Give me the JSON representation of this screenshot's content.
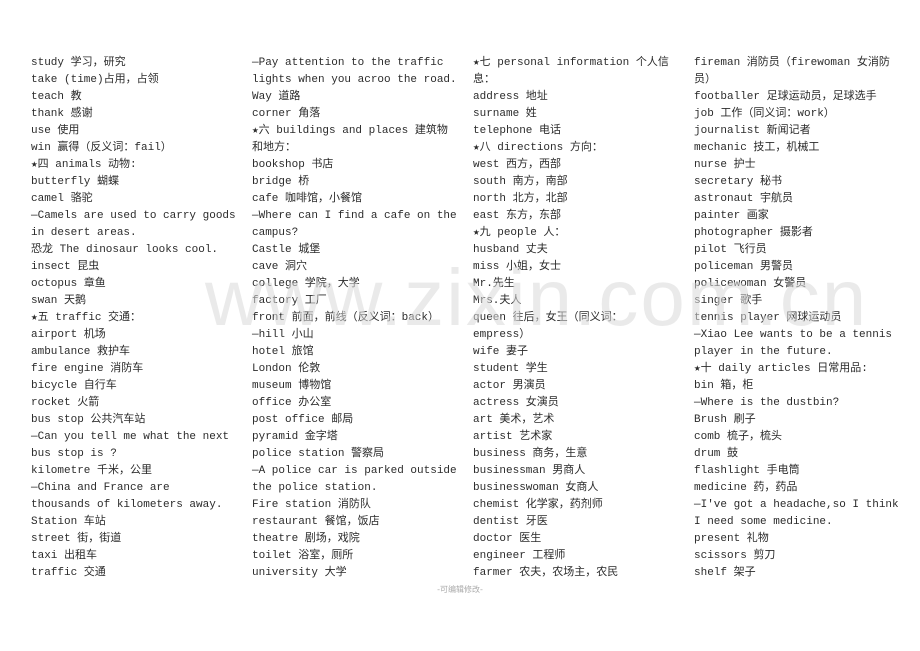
{
  "columns": [
    {
      "lines": [
        "study 学习，研究",
        "take (time)占用，占领",
        "teach 教",
        "thank 感谢",
        "use 使用",
        "win 赢得（反义词：fail）",
        "★四 animals 动物:",
        "butterfly 蝴蝶",
        "camel 骆驼",
        "—Camels are used to carry goods",
        "in desert areas.",
        "恐龙 The dinosaur looks cool.",
        "insect 昆虫",
        "octopus 章鱼",
        "swan 天鹅",
        "★五 traffic 交通：",
        "airport 机场",
        "ambulance 救护车",
        "fire engine 消防车",
        "bicycle 自行车",
        "rocket 火箭",
        "bus stop 公共汽车站",
        "—Can you tell me what the next",
        "bus stop is ?",
        "kilometre 千米，公里",
        "—China and France are",
        "thousands of kilometers away.",
        "Station 车站",
        "street 街，街道",
        "taxi 出租车",
        "traffic 交通"
      ]
    },
    {
      "lines": [
        "—Pay attention to the traffic",
        "lights when you acroo the road.",
        "Way 道路",
        "corner 角落",
        "★六 buildings and places 建筑物",
        "和地方：",
        "bookshop 书店",
        "bridge 桥",
        "cafe 咖啡馆，小餐馆",
        "—Where can I find a cafe on the",
        "campus?",
        " Castle 城堡",
        "cave 洞穴",
        "college 学院，大学",
        "factory 工厂",
        "front 前面，前线（反义词：back）",
        "—hill 小山",
        "hotel 旅馆",
        "London 伦敦",
        "museum 博物馆",
        "office 办公室",
        "post office 邮局",
        "pyramid 金字塔",
        "police station 警察局",
        "—A police car is parked outside",
        "the police station.",
        "Fire station 消防队",
        "restaurant 餐馆，饭店",
        "theatre 剧场，戏院",
        "toilet 浴室，厕所",
        "university 大学"
      ]
    },
    {
      "lines": [
        "★七 personal information 个人信",
        "息：",
        "address 地址",
        "surname 姓",
        "telephone 电话",
        "★八 directions 方向：",
        "west 西方，西部",
        "south 南方，南部",
        "north 北方，北部",
        "east 东方，东部",
        "★九 people 人：",
        "husband 丈夫",
        "miss 小姐，女士",
        "Mr.先生",
        "Mrs.夫人",
        "queen 往后，女王（同义词：",
        "empress）",
        "wife 妻子",
        "student 学生",
        "actor 男演员",
        "actress 女演员",
        "art 美术，艺术",
        "artist 艺术家",
        "business 商务，生意",
        "businessman 男商人",
        "businesswoman 女商人",
        "chemist 化学家，药剂师",
        "dentist 牙医",
        "doctor 医生",
        "engineer 工程师",
        "farmer 农夫，农场主，农民"
      ]
    },
    {
      "lines": [
        "fireman 消防员（firewoman 女消防",
        "员）",
        "footballer 足球运动员，足球选手",
        "job 工作（同义词：work）",
        "journalist 新闻记者",
        "mechanic 技工，机械工",
        "nurse 护士",
        "secretary 秘书",
        "astronaut 宇航员",
        "painter 画家",
        "photographer 摄影者",
        "pilot 飞行员",
        "policeman 男警员",
        "policewoman 女警员",
        "singer 歌手",
        "tennis player 网球运动员",
        "—Xiao Lee wants to be a tennis",
        "player in the future.",
        "★十 daily articles 日常用品:",
        "bin 箱，柜",
        "—Where is the dustbin?",
        "Brush 刷子",
        "comb 梳子，梳头",
        "drum 鼓",
        "flashlight 手电筒",
        "medicine 药，药品",
        "—I've got a headache,so I think",
        "I need some medicine.",
        "present 礼物",
        "scissors 剪刀",
        "shelf 架子"
      ]
    }
  ],
  "watermark": "www.zixin.com.cn",
  "footer": "-可编辑修改-"
}
